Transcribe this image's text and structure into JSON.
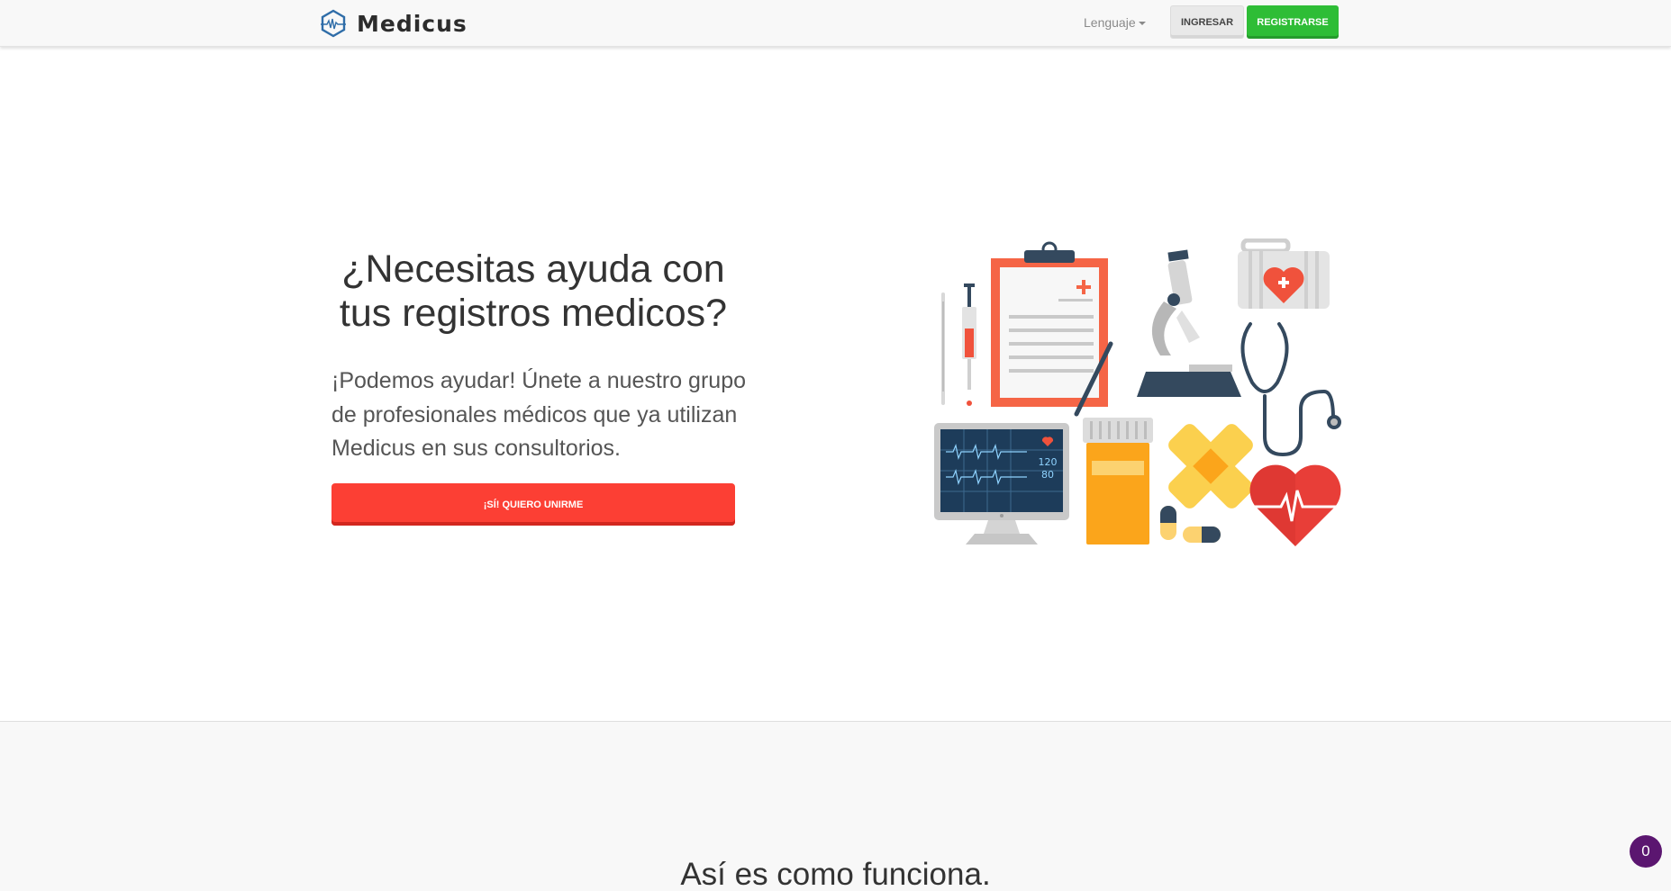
{
  "navbar": {
    "brand_name": "Medicus",
    "language_label": "Lenguaje",
    "login_label": "INGRESAR",
    "register_label": "REGISTRARSE"
  },
  "hero": {
    "title": "¿Necesitas ayuda con tus registros medicos?",
    "text": "¡Podemos ayudar! Únete a nuestro grupo de profesionales médicos que ya utilizan Medicus en sus consultorios.",
    "cta_label": "¡SÍ! QUIERO UNIRME",
    "monitor_readout_top": "120",
    "monitor_readout_bottom": "80"
  },
  "how_it_works": {
    "title": "Así es como funciona."
  },
  "chat_badge": {
    "count": "0"
  },
  "colors": {
    "brand_blue": "#2f6da8",
    "register_green": "#2ebd36",
    "cta_red": "#fc3f34",
    "chat_purple": "#5b1670"
  },
  "icons": [
    "brand-hexagon-heartbeat-icon",
    "caret-down-icon",
    "thermometer-icon",
    "syringe-icon",
    "clipboard-icon",
    "pen-icon",
    "microscope-icon",
    "first-aid-kit-icon",
    "stethoscope-icon",
    "heart-monitor-icon",
    "pill-bottle-icon",
    "bandage-icon",
    "capsule-icon",
    "heart-pulse-icon"
  ]
}
